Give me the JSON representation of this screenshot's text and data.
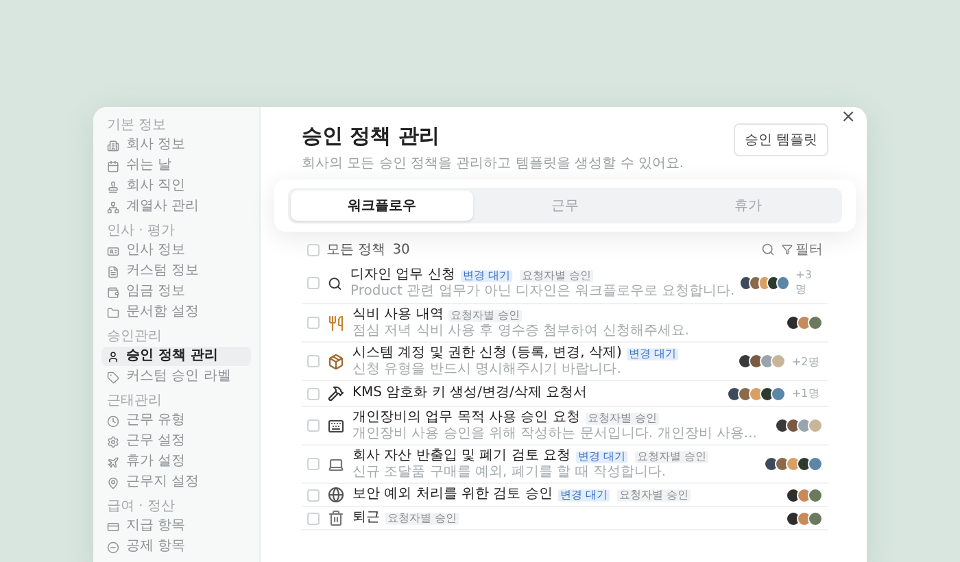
{
  "sidebar": {
    "groups": [
      {
        "label": "기본 정보",
        "items": [
          {
            "label": "회사 정보",
            "selected": false
          },
          {
            "label": "쉬는 날",
            "selected": false
          },
          {
            "label": "회사 직인",
            "selected": false
          },
          {
            "label": "계열사 관리",
            "selected": false
          }
        ]
      },
      {
        "label": "인사 · 평가",
        "items": [
          {
            "label": "인사 정보",
            "selected": false
          },
          {
            "label": "커스텀 정보",
            "selected": false
          },
          {
            "label": "임금 정보",
            "selected": false
          },
          {
            "label": "문서함 설정",
            "selected": false
          }
        ]
      },
      {
        "label": "승인관리",
        "items": [
          {
            "label": "승인 정책 관리",
            "selected": true
          },
          {
            "label": "커스텀 승인 라벨",
            "selected": false
          }
        ]
      },
      {
        "label": "근태관리",
        "items": [
          {
            "label": "근무 유형",
            "selected": false
          },
          {
            "label": "근무 설정",
            "selected": false
          },
          {
            "label": "휴가 설정",
            "selected": false
          },
          {
            "label": "근무지 설정",
            "selected": false
          }
        ]
      },
      {
        "label": "급여 · 정산",
        "items": [
          {
            "label": "지급 항목",
            "selected": false
          },
          {
            "label": "공제 항목",
            "selected": false
          }
        ]
      }
    ]
  },
  "close": "×",
  "title": "승인 정책 관리",
  "subtitle": "회사의 모든 승인 정책을 관리하고 템플릿을 생성할 수 있어요.",
  "template_button": "승인 템플릿",
  "tabs": [
    {
      "label": "워크플로우",
      "selected": true
    },
    {
      "label": "근무",
      "selected": false
    },
    {
      "label": "휴가",
      "selected": false
    }
  ],
  "list_header": {
    "label": "모든 정책",
    "count": "30",
    "checked": false,
    "filter": "필터"
  },
  "policies": [
    {
      "title": "디자인 업무 신청",
      "tags": [
        {
          "label": "변경 대기",
          "kind": "pending"
        },
        {
          "label": "요청자별 승인",
          "kind": "approver"
        }
      ],
      "description": "Product 관련 업무가 아닌 디자인은 워크플로우로 요청합니다.",
      "checked": false,
      "avatars": [
        {
          "color": "#3c4a5c"
        },
        {
          "color": "#8a6a4a"
        },
        {
          "color": "#d9a066"
        },
        {
          "color": "#2d3a2e"
        },
        {
          "color": "#5b86a8"
        }
      ],
      "more": "+3명"
    },
    {
      "title": "식비 사용 내역",
      "tags": [
        {
          "label": "요청자별 승인",
          "kind": "approver"
        }
      ],
      "description": "점심 저녁 식비 사용 후 영수증 첨부하여 신청해주세요.",
      "checked": false,
      "avatars": [
        {
          "color": "#2e2e2e"
        },
        {
          "color": "#c98a5a"
        },
        {
          "color": "#6b7a5e"
        }
      ]
    },
    {
      "title": "시스템 계정 및 권한 신청 (등록, 변경, 삭제)",
      "tags": [
        {
          "label": "변경 대기",
          "kind": "pending"
        }
      ],
      "description": "신청 유형을 반드시 명시해주시기 바랍니다.",
      "checked": false,
      "avatars": [
        {
          "color": "#3a3a3a"
        },
        {
          "color": "#7b5a44"
        },
        {
          "color": "#9aa4ad"
        },
        {
          "color": "#c9b59a"
        }
      ],
      "more": "+2명"
    },
    {
      "title": "KMS 암호화 키 생성/변경/삭제 요청서",
      "checked": false,
      "avatars": [
        {
          "color": "#3c4a5c"
        },
        {
          "color": "#8a6a4a"
        },
        {
          "color": "#d9a066"
        },
        {
          "color": "#2d3a2e"
        },
        {
          "color": "#5b86a8"
        }
      ],
      "more": "+1명"
    },
    {
      "title": "개인장비의 업무 목적 사용 승인 요청",
      "tags": [
        {
          "label": "요청자별 승인",
          "kind": "approver"
        }
      ],
      "description": "개인장비 사용 승인을 위해 작성하는 문서입니다. 개인장비 사용...",
      "checked": false,
      "avatars": [
        {
          "color": "#3a3a3a"
        },
        {
          "color": "#7b5a44"
        },
        {
          "color": "#9aa4ad"
        },
        {
          "color": "#c9b59a"
        }
      ]
    },
    {
      "title": "회사 자산 반출입 및 폐기 검토 요청",
      "tags": [
        {
          "label": "변경 대기",
          "kind": "pending"
        },
        {
          "label": "요청자별 승인",
          "kind": "approver"
        }
      ],
      "description": "신규 조달품 구매를 예외, 폐기를 할 때 작성합니다.",
      "checked": false,
      "avatars": [
        {
          "color": "#3c4a5c"
        },
        {
          "color": "#8a6a4a"
        },
        {
          "color": "#d9a066"
        },
        {
          "color": "#2d3a2e"
        },
        {
          "color": "#5b86a8"
        }
      ]
    },
    {
      "title": "보안 예외 처리를 위한 검토 승인",
      "tags": [
        {
          "label": "변경 대기",
          "kind": "pending"
        },
        {
          "label": "요청자별 승인",
          "kind": "approver"
        }
      ],
      "checked": false,
      "avatars": [
        {
          "color": "#2e2e2e"
        },
        {
          "color": "#c98a5a"
        },
        {
          "color": "#6b7a5e"
        }
      ]
    },
    {
      "title": "퇴근",
      "tags": [
        {
          "label": "요청자별 승인",
          "kind": "approver"
        }
      ],
      "checked": false,
      "avatars": [
        {
          "color": "#2e2e2e"
        },
        {
          "color": "#c98a5a"
        },
        {
          "color": "#6b7a5e"
        }
      ]
    }
  ]
}
